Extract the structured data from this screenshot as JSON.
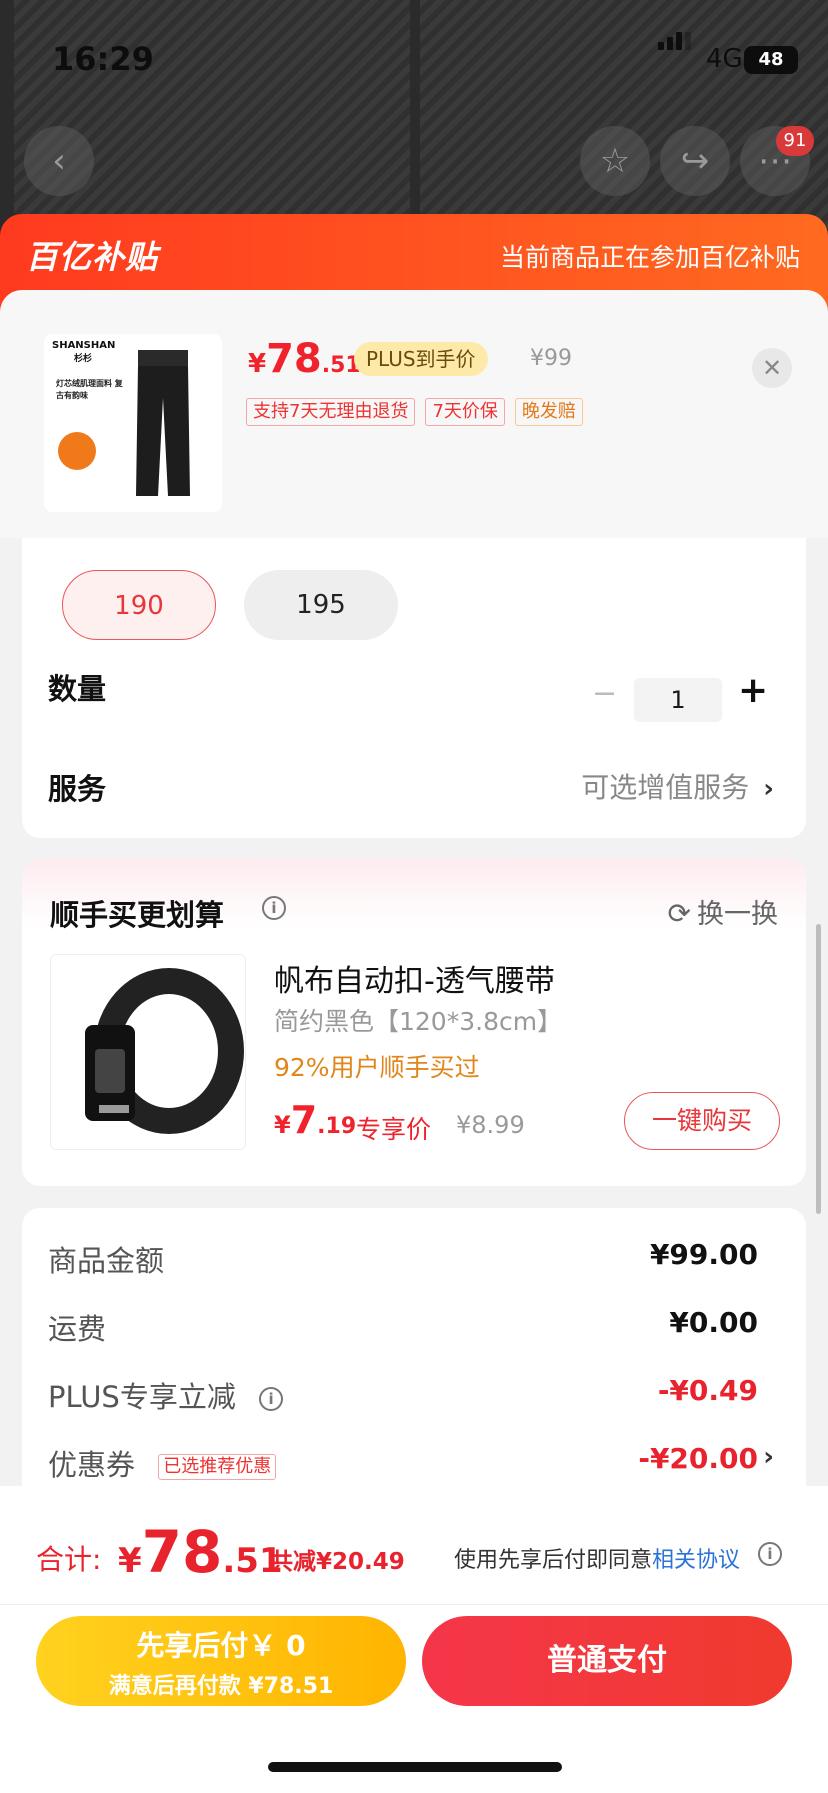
{
  "status_bar": {
    "time": "16:29",
    "network": "4G",
    "battery": "48"
  },
  "nav": {
    "cart_badge": "91",
    "back_icon": "chevron-left-icon",
    "favorite_icon": "star-icon",
    "share_icon": "share-icon",
    "more_icon": "more-icon"
  },
  "banner": {
    "logo": "百亿补贴",
    "note": "当前商品正在参加百亿补贴"
  },
  "product": {
    "brand": "SHANSHAN",
    "brand_cn": "杉杉",
    "thumb_caption": "灯芯绒肌理面料 复古有韵味",
    "price_currency": "¥",
    "price_int": "78",
    "price_dec": ".51",
    "plus_tag": "PLUS到手价",
    "original_price": "¥99",
    "tags": [
      "支持7天无理由退货",
      "7天价保"
    ],
    "tag_orange": "晚发赔"
  },
  "sizes": {
    "selected": "190",
    "option": "195"
  },
  "quantity": {
    "label": "数量",
    "value": "1",
    "minus": "−",
    "plus": "+"
  },
  "service": {
    "label": "服务",
    "value": "可选增值服务",
    "arrow": "›"
  },
  "addon": {
    "title": "顺手买更划算",
    "refresh": "换一换",
    "name": "帆布自动扣-透气腰带",
    "spec": "简约黑色【120*3.8cm】",
    "social": "92%用户顺手买过",
    "price_currency": "¥",
    "price_int": "7",
    "price_dec": ".19",
    "exclusive": "专享价",
    "original_price": "¥8.99",
    "buy_button": "一键购买"
  },
  "summary": {
    "goods_label": "商品金额",
    "goods_value": "¥99.00",
    "shipping_label": "运费",
    "shipping_value": "¥0.00",
    "plus_label": "PLUS专享立减",
    "plus_value": "-¥0.49",
    "coupon_label": "优惠券",
    "coupon_tag": "已选推荐优惠",
    "coupon_value": "-¥20.00"
  },
  "checkout": {
    "total_label": "合计:",
    "total_currency": "¥",
    "total_int": "78",
    "total_dec": ".51",
    "total_save": "共减¥20.49",
    "agree_text": "使用先享后付即同意",
    "agree_link": "相关协议",
    "pay_later_line1": "先享后付￥ 0",
    "pay_later_line2": "满意后再付款 ¥78.51",
    "pay_normal": "普通支付"
  },
  "colors": {
    "accent": "#f0232d",
    "banner": "#ff4a1f",
    "pay_later": "#ffc20f",
    "pay_normal": "#f23a3e"
  }
}
